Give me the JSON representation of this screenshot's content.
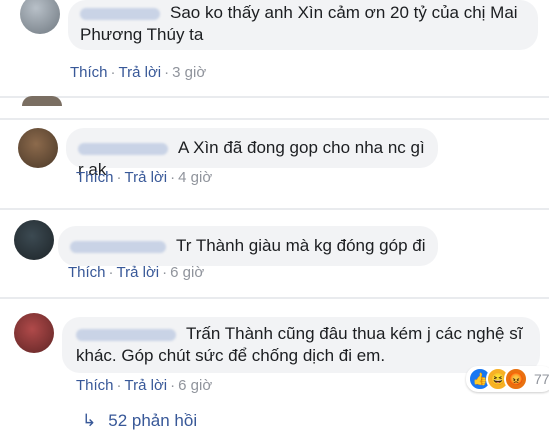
{
  "comments": [
    {
      "text": "Sao ko thấy anh Xìn cảm ơn 20 tỷ của chị Mai Phương Thúy ta",
      "like": "Thích",
      "reply": "Trả lời",
      "time": "3 giờ"
    },
    {
      "text": "A Xìn đã đong gop cho nha nc gì r ak",
      "like": "Thích",
      "reply": "Trả lời",
      "time": "4 giờ"
    },
    {
      "text": "Tr Thành giàu mà kg đóng góp đi",
      "like": "Thích",
      "reply": "Trả lời",
      "time": "6 giờ"
    },
    {
      "text": "Trấn Thành cũng đâu thua kém j các nghệ sĩ khác. Góp chút sức để chống dịch đi em.",
      "like": "Thích",
      "reply": "Trả lời",
      "time": "6 giờ"
    }
  ],
  "dot": "·",
  "reactions": {
    "count": "77",
    "types": [
      "like-icon",
      "haha-icon",
      "angry-icon"
    ]
  },
  "replies_label": "52 phản hồi",
  "colors": {
    "link": "#385898",
    "bubble": "#f2f3f5",
    "muted": "#90949c"
  }
}
